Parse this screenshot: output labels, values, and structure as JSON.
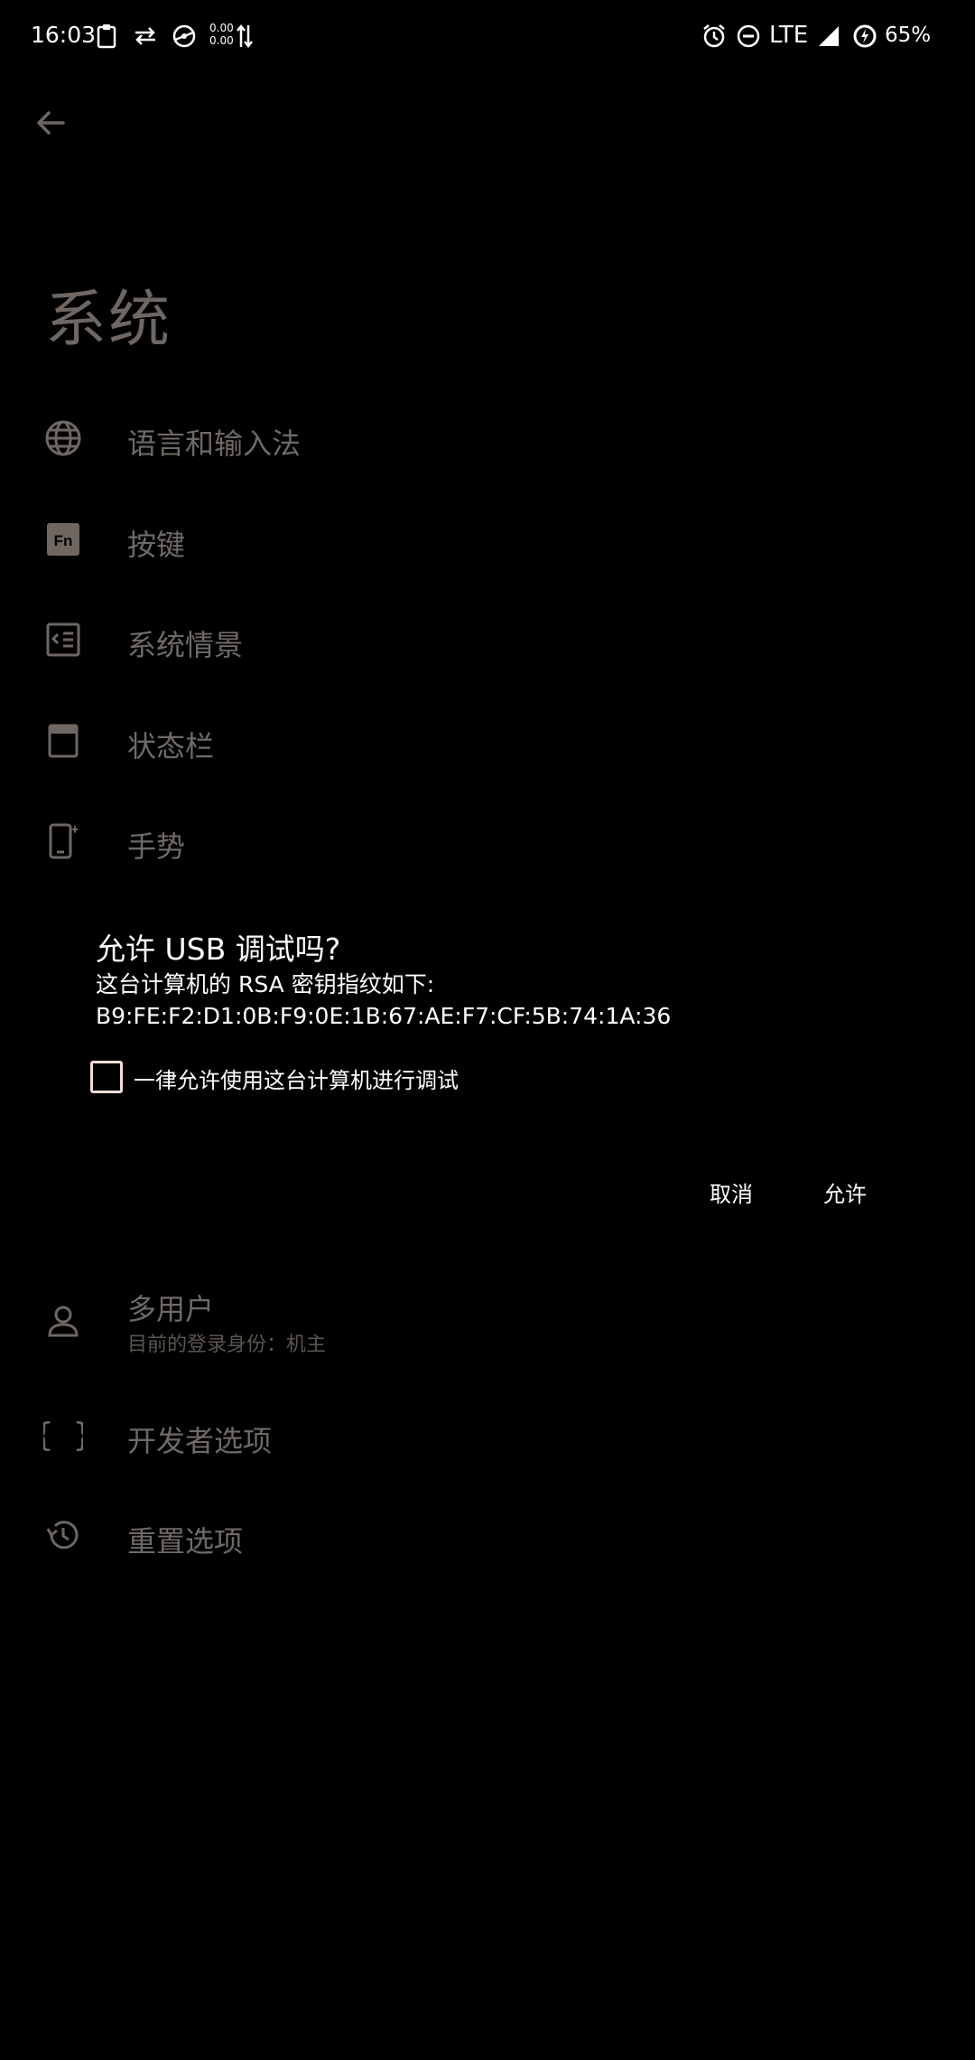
{
  "status_bar": {
    "time": "16:03",
    "net_speed_up": "0.00",
    "net_speed_down": "0.00",
    "network": "LTE",
    "battery": "65%",
    "icons": [
      "clipboard-icon",
      "swap-icon",
      "vpn-icon",
      "data-arrows-icon",
      "alarm-icon",
      "do-not-disturb-icon",
      "signal-icon",
      "battery-icon"
    ]
  },
  "header": {
    "title": "系统",
    "back_icon": "arrow-left-icon"
  },
  "settings": {
    "items": [
      {
        "label": "语言和输入法",
        "icon": "globe-icon"
      },
      {
        "label": "按键",
        "icon": "fn-key-icon"
      },
      {
        "label": "系统情景",
        "icon": "system-scene-icon"
      },
      {
        "label": "状态栏",
        "icon": "status-bar-icon"
      },
      {
        "label": "手势",
        "icon": "gesture-phone-icon"
      }
    ],
    "lower_items": [
      {
        "label": "多用户",
        "sublabel": "目前的登录身份：机主",
        "icon": "person-icon"
      },
      {
        "label": "开发者选项",
        "icon": "braces-icon"
      },
      {
        "label": "重置选项",
        "icon": "history-icon"
      }
    ]
  },
  "dialog": {
    "title": "允许 USB 调试吗?",
    "message_line1": "这台计算机的 RSA 密钥指纹如下:",
    "message_line2": "B9:FE:F2:D1:0B:F9:0E:1B:67:AE:F7:CF:5B:74:1A:36",
    "checkbox_label": "一律允许使用这台计算机进行调试",
    "checkbox_checked": false,
    "cancel_label": "取消",
    "allow_label": "允许"
  },
  "colors": {
    "background": "#000000",
    "dim_text": "#6f6a66",
    "checkbox_border": "#f2dcd6"
  }
}
